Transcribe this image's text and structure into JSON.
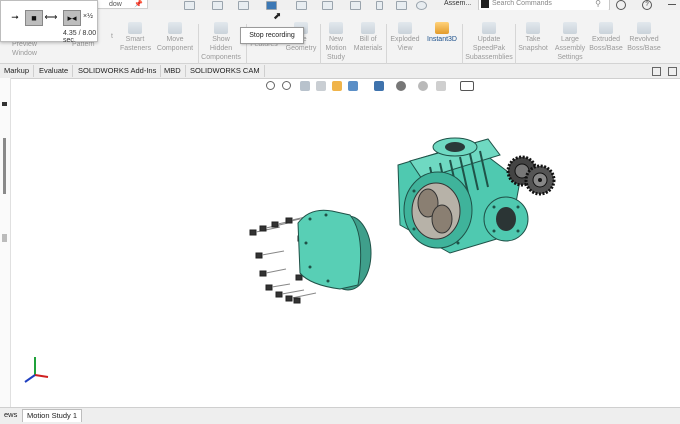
{
  "window": {
    "tab_title": "dow",
    "assembly_label": "Assem...",
    "search_placeholder": "Search Commands"
  },
  "player": {
    "time": "4.35 / 8.00 sec.",
    "speed": "×½"
  },
  "tooltip": "Stop recording",
  "ribbon": {
    "partial_left": [
      "Preview",
      "Window",
      "Pattern"
    ],
    "commands": [
      {
        "id": "smart-fasteners",
        "label": "Smart\nFasteners"
      },
      {
        "id": "move-component",
        "label": "Move\nComponent"
      },
      {
        "id": "show-hidden",
        "label": "Show\nHidden\nComponents"
      },
      {
        "id": "features",
        "label": "Features"
      },
      {
        "id": "reference-geometry",
        "label": "Geometry"
      },
      {
        "id": "new-motion-study",
        "label": "New\nMotion\nStudy"
      },
      {
        "id": "bill-of-materials",
        "label": "Bill of\nMaterials"
      },
      {
        "id": "exploded-view",
        "label": "Exploded\nView"
      },
      {
        "id": "instant3d",
        "label": "Instant3D"
      },
      {
        "id": "update-speedpak",
        "label": "Update\nSpeedPak\nSubassemblies"
      },
      {
        "id": "take-snapshot",
        "label": "Take\nSnapshot"
      },
      {
        "id": "large-assembly",
        "label": "Large\nAssembly\nSettings"
      },
      {
        "id": "extruded-boss",
        "label": "Extruded\nBoss/Base"
      },
      {
        "id": "revolved-boss",
        "label": "Revolved\nBoss/Base"
      }
    ],
    "partial_texts": [
      "t",
      "nce"
    ]
  },
  "tabs": [
    "Markup",
    "Evaluate",
    "SOLIDWORKS Add-Ins",
    "MBD",
    "SOLIDWORKS CAM"
  ],
  "bottom_tabs": [
    "ews",
    "Motion Study 1"
  ],
  "colors": {
    "model": "#4fc9b0",
    "model_dark": "#2d8a77",
    "gear": "#3a3a3a",
    "accent_active": "#e39b2a"
  },
  "icons": [
    "zoom-to-fit-icon",
    "zoom-area-icon",
    "previous-view-icon",
    "section-view-icon",
    "dynamic-annotation-icon",
    "view-orientation-icon",
    "display-style-icon",
    "hide-show-icon",
    "edit-appearance-icon",
    "apply-scene-icon",
    "view-settings-icon"
  ]
}
